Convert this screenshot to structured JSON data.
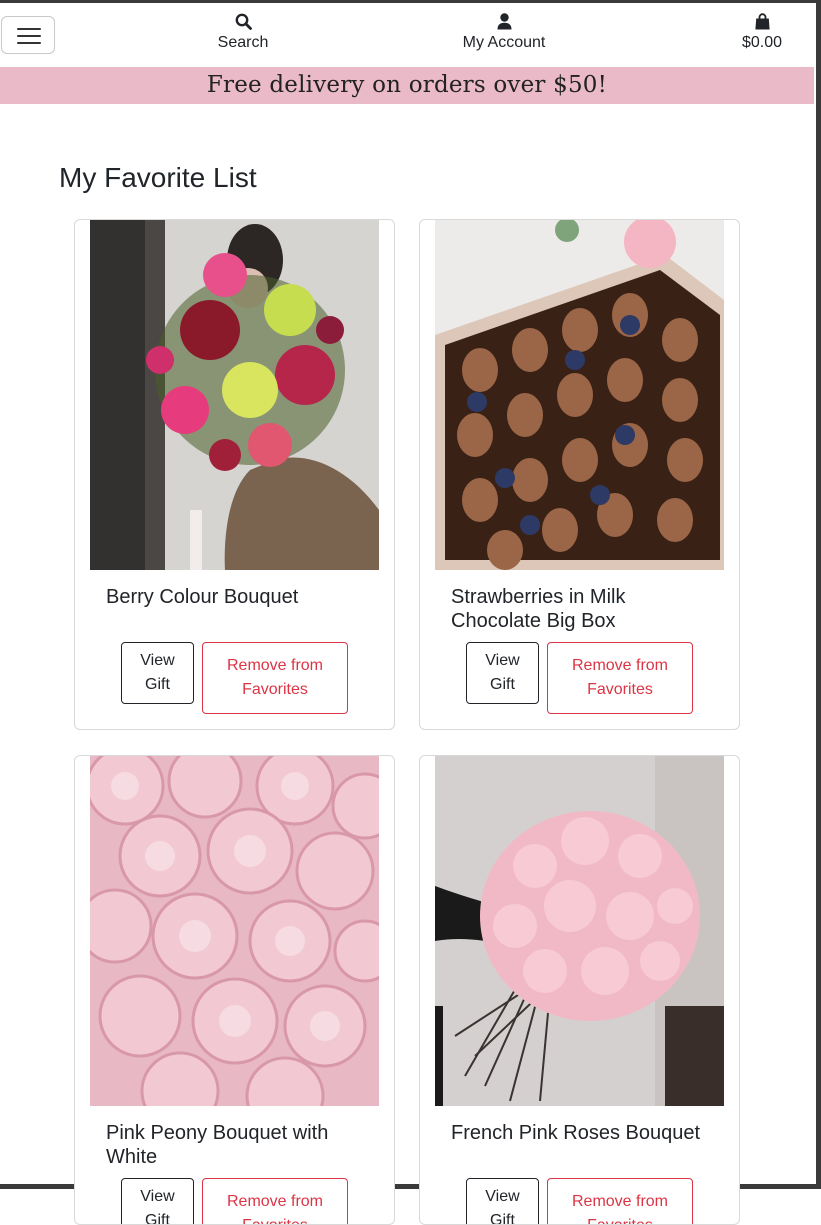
{
  "nav": {
    "search_label": "Search",
    "account_label": "My Account",
    "cart_total": "$0.00",
    "icons": [
      "menu-icon",
      "search-icon",
      "user-icon",
      "shopping-bag-icon"
    ]
  },
  "banner": {
    "text": "Free delivery on orders over $50!"
  },
  "page": {
    "title": "My Favorite List"
  },
  "favorites": [
    {
      "name": "Berry Colour Bouquet",
      "view_label": "View Gift",
      "remove_label": "Remove from Favorites"
    },
    {
      "name": "Strawberries in Milk Chocolate Big Box",
      "view_label": "View Gift",
      "remove_label": "Remove from Favorites"
    },
    {
      "name": "Pink Peony Bouquet with White",
      "view_label": "View Gift",
      "remove_label": "Remove from Favorites"
    },
    {
      "name": "French Pink Roses Bouquet",
      "view_label": "View Gift",
      "remove_label": "Remove from Favorites"
    }
  ],
  "colors": {
    "banner": "#ebbac9",
    "remove_button": "#dc3545",
    "text": "#212529"
  }
}
